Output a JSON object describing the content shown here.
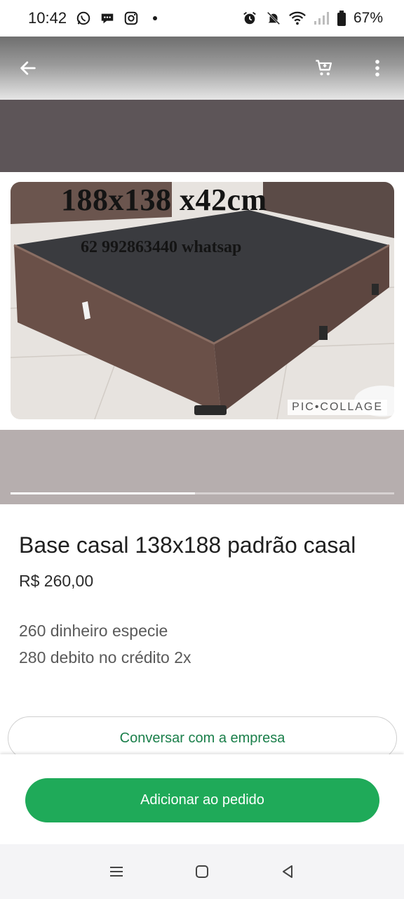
{
  "status_bar": {
    "time": "10:42",
    "battery_percent": "67%",
    "left_icons": [
      "whatsapp-icon",
      "chat-bubble-icon",
      "instagram-icon",
      "dot-icon"
    ],
    "right_icons": [
      "alarm-icon",
      "bell-off-icon",
      "wifi-icon",
      "signal-icon",
      "battery-icon"
    ]
  },
  "app_bar": {
    "back_icon": "arrow-left-icon",
    "cart_icon": "cart-icon",
    "menu_icon": "more-vert-icon"
  },
  "image": {
    "overlay_title": "188x138 x42cm",
    "overlay_phone": "62 992863440 whatsap",
    "watermark": "PIC•COLLAGE",
    "carousel_progress": 0.48
  },
  "product": {
    "title": "Base casal 138x188 padrão casal",
    "price": "R$ 260,00",
    "description_lines": [
      "260 dinheiro especie",
      "280 debito no crédito 2x"
    ]
  },
  "actions": {
    "chat_label": "Conversar com a empresa",
    "add_label": "Adicionar ao pedido"
  },
  "colors": {
    "accent_green": "#1faa59",
    "link_green": "#1a7f4a"
  },
  "nav": {
    "icons": [
      "recent-apps-icon",
      "home-icon",
      "back-icon"
    ]
  }
}
